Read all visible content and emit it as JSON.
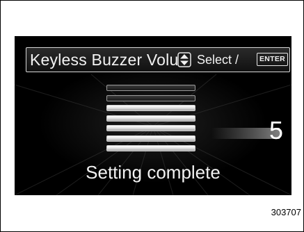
{
  "display": {
    "title": "Keyless Buzzer Volume",
    "select_label": "Select /",
    "enter_label": "ENTER",
    "updown_icon": "up-down-arrow-icon",
    "level": {
      "value": "5",
      "active_segments": 5,
      "total_segments": 7
    },
    "status": "Setting complete"
  },
  "figure": {
    "id": "303707"
  },
  "colors": {
    "screen_background": "#000000",
    "text": "#f2f2f2",
    "frame": "#000000"
  }
}
